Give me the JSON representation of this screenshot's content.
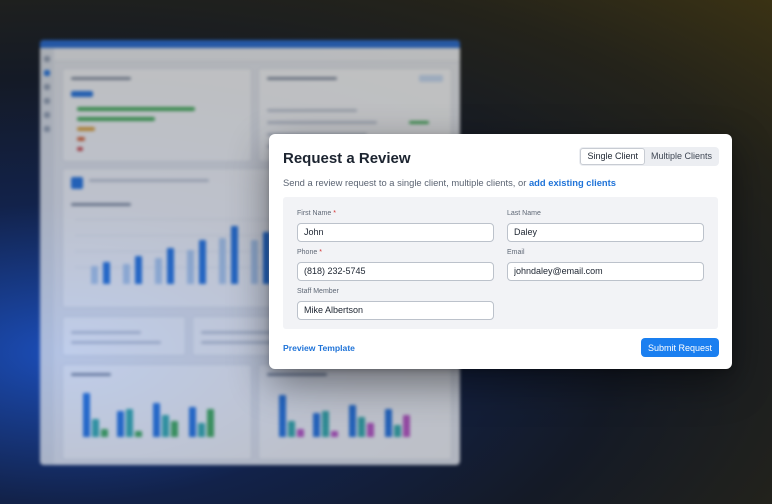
{
  "modal": {
    "title": "Request a Review",
    "toggle": {
      "single": "Single Client",
      "multiple": "Multiple Clients",
      "selected": "Single Client"
    },
    "subtitle_text": "Send a review request to a single client, multiple clients, or ",
    "subtitle_link": "add existing clients",
    "fields": {
      "first_name": {
        "label": "First Name",
        "required": "*",
        "value": "John"
      },
      "last_name": {
        "label": "Last Name",
        "value": "Daley"
      },
      "phone": {
        "label": "Phone",
        "required": "*",
        "value": "(818) 232-5745"
      },
      "email": {
        "label": "Email",
        "value": "johndaley@email.com"
      },
      "staff": {
        "label": "Staff Member",
        "value": "Mike Albertson"
      }
    },
    "preview_link": "Preview Template",
    "submit_label": "Submit Request"
  },
  "colors": {
    "accent": "#1a7ff0",
    "link": "#1f73d8",
    "required": "#d23232",
    "background_dark": "#141a26"
  }
}
